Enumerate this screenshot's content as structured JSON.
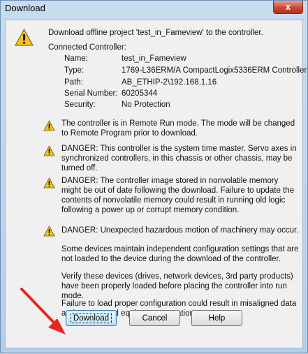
{
  "window": {
    "title": "Download",
    "close_label": "x"
  },
  "intro": "Download offline project 'test_in_Fameview' to the controller.",
  "connected": {
    "heading": "Connected Controller:",
    "rows": [
      {
        "label": "Name:",
        "value": "test_in_Fameview"
      },
      {
        "label": "Type:",
        "value": "1769-L36ERM/A CompactLogix5336ERM Controller"
      },
      {
        "label": "Path:",
        "value": "AB_ETHIP-2\\192.168.1.16"
      },
      {
        "label": "Serial Number:",
        "value": "60205344"
      },
      {
        "label": "Security:",
        "value": "No Protection"
      }
    ]
  },
  "warnings": [
    "The controller is in Remote Run mode. The mode will be changed to Remote Program prior to download.",
    "DANGER: This controller is the system time master.  Servo axes in synchronized controllers, in this chassis or other chassis, may be turned off.",
    "DANGER: The controller image stored in nonvolatile memory might be out of date following the download. Failure to update the contents of nonvolatile memory could result in running old logic following a power up or corrupt memory condition.",
    "DANGER: Unexpected hazardous motion of machinery may occur."
  ],
  "notes": [
    "Some devices maintain independent configuration settings that are not loaded to the device during the download of the controller.",
    "Verify these devices (drives, network devices, 3rd party products) have been properly loaded before placing the controller into run mode.",
    "Failure to load proper configuration could result in misaligned data and unexpected equipment operation."
  ],
  "buttons": {
    "download": "Download",
    "cancel": "Cancel",
    "help": "Help"
  },
  "colors": {
    "warning": "#f3c21b",
    "arrow": "#e8281e",
    "accent": "#3c7fb1"
  }
}
